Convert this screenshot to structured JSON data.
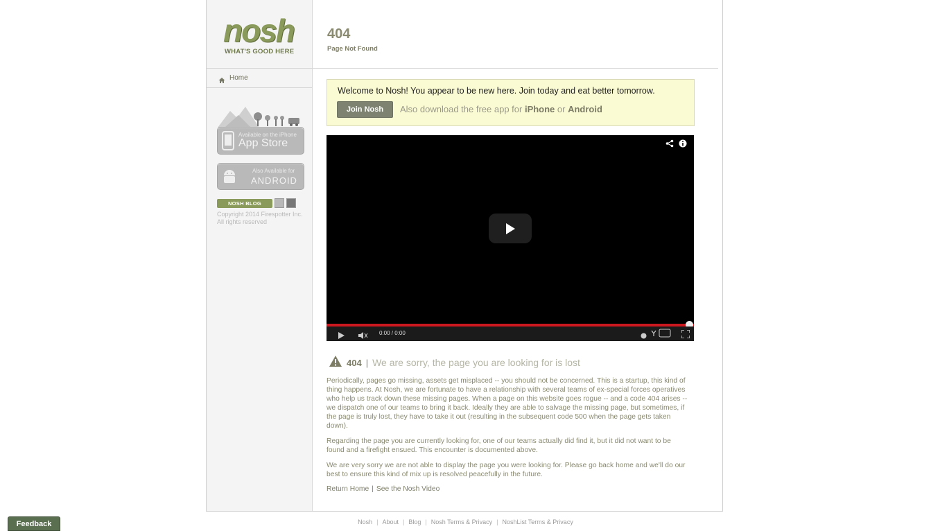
{
  "brand": {
    "logo_word": "nosh",
    "tagline": "WHAT'S GOOD HERE"
  },
  "sidebar": {
    "home_label": "Home",
    "appstore": {
      "small": "Available on the iPhone",
      "big": "App Store"
    },
    "android": {
      "small": "Also Available for",
      "big": "ANDROID"
    },
    "blog_label": "NOSH BLOG",
    "copyright_line1": "Copyright 2014 Firespotter Inc.",
    "copyright_line2": "All rights reserved"
  },
  "header": {
    "code": "404",
    "subtitle": "Page Not Found"
  },
  "welcome": {
    "text": "Welcome to Nosh! You appear to be new here. Join today and eat better tomorrow.",
    "join_label": "Join Nosh",
    "download_prefix": "Also download the free app for ",
    "iphone": "iPhone",
    "or": " or ",
    "android": "Android"
  },
  "video": {
    "time": "0:00 / 0:00",
    "progress": 1.0
  },
  "error": {
    "code": "404",
    "separator": "|",
    "message": "We are sorry, the page you are looking for is lost"
  },
  "body": {
    "p1": "Periodically, pages go missing, assets get misplaced -- you should not be concerned. This is a startup, this kind of thing happens. At Nosh, we are fortunate to have a relationship with several teams of ex-special forces operatives who help us track down these missing pages. When a page on this website goes rogue -- and a code 404 arises -- we dispatch one of our teams to bring it back. Ideally they are able to salvage the missing page, but sometimes, if the page is truly lost, they have to take it out (resulting in the subsequent code 500 when the page gets taken down).",
    "p2": "Regarding the page you are currently looking for, one of our teams actually did find it, but it did not want to be found and a firefight ensued. This encounter is documented above.",
    "p3": "We are very sorry we are not able to display the page you were looking for. Please go back home and we'll do our best to ensure this kind of mix up is resolved peacefully in the future.",
    "link_home": "Return Home",
    "link_sep": "|",
    "link_video": "See the Nosh Video"
  },
  "footer": {
    "links": [
      "Nosh",
      "About",
      "Blog",
      "Nosh Terms & Privacy",
      "NoshList Terms & Privacy"
    ],
    "pipe": "|"
  },
  "feedback_label": "Feedback",
  "colors": {
    "brand_green": "#8a9a5a",
    "welcome_bg": "#fbfbd3",
    "progress_red": "#cc181e",
    "feedback_bg": "#5a6e50"
  }
}
